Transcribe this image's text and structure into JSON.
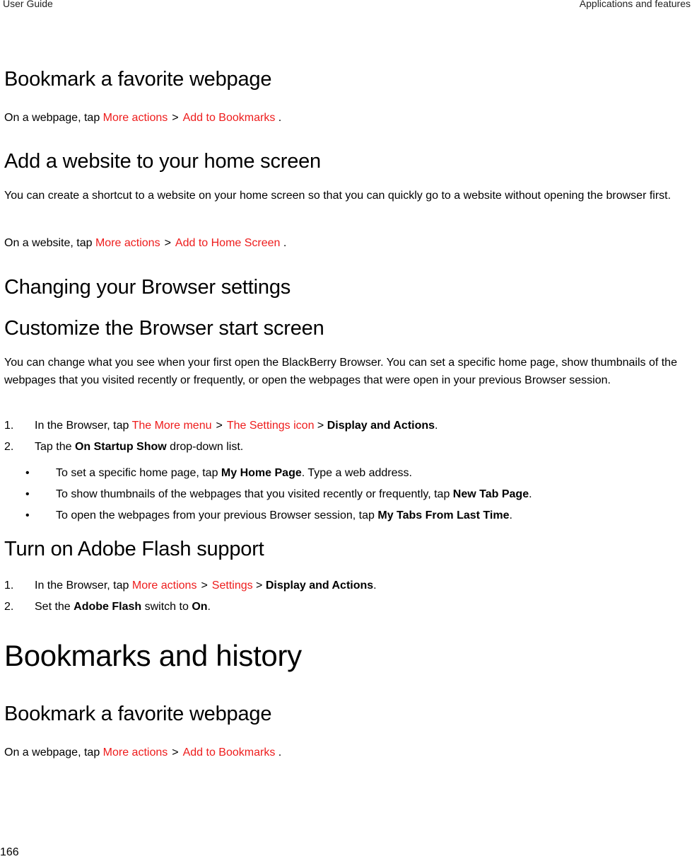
{
  "header": {
    "left": "User Guide",
    "right": "Applications and features"
  },
  "sections": {
    "bookmark1": {
      "title": "Bookmark a favorite webpage",
      "pre": "On a webpage, tap ",
      "link1": "More actions",
      "sep": ">",
      "link2": "Add to Bookmarks",
      "post": " ."
    },
    "homescreen": {
      "title": "Add a website to your home screen",
      "desc": "You can create a shortcut to a website on your home screen so that you can quickly go to a website without opening the browser first.",
      "pre": "On a website, tap ",
      "link1": "More actions",
      "sep": ">",
      "link2": "Add to Home Screen",
      "post": " ."
    },
    "settings": {
      "title": "Changing your Browser settings"
    },
    "startscreen": {
      "title": "Customize the Browser start screen",
      "desc": "You can change what you see when your first open the BlackBerry Browser. You can set a specific home page, show thumbnails of the webpages that you visited recently or frequently, or open the webpages that were open in your previous Browser session.",
      "steps": [
        {
          "num": "1.",
          "pre": "In the Browser, tap ",
          "link1": "The More menu",
          "sep": ">",
          "link2": "The Settings icon",
          "sep2": " > ",
          "bold": "Display and Actions",
          "post": "."
        },
        {
          "num": "2.",
          "pre": "Tap the ",
          "bold": "On Startup Show",
          "post": " drop-down list."
        }
      ],
      "bullets": [
        {
          "mark": "•",
          "pre": "To set a specific home page, tap ",
          "bold": "My Home Page",
          "post": ". Type a web address."
        },
        {
          "mark": "•",
          "pre": "To show thumbnails of the webpages that you visited recently or frequently, tap ",
          "bold": "New Tab Page",
          "post": "."
        },
        {
          "mark": "•",
          "pre": "To open the webpages from your previous Browser session, tap ",
          "bold": "My Tabs From Last Time",
          "post": "."
        }
      ]
    },
    "flash": {
      "title": "Turn on Adobe Flash support",
      "steps": [
        {
          "num": "1.",
          "pre": "In the Browser, tap ",
          "link1": "More actions",
          "sep": ">",
          "link2": "Settings",
          "sep2": " > ",
          "bold": "Display and Actions",
          "post": "."
        },
        {
          "num": "2.",
          "pre": "Set the ",
          "bold": "Adobe Flash",
          "mid": " switch to ",
          "bold2": "On",
          "post": "."
        }
      ]
    },
    "history": {
      "title": "Bookmarks and history"
    },
    "bookmark2": {
      "title": "Bookmark a favorite webpage",
      "pre": "On a webpage, tap ",
      "link1": "More actions",
      "sep": ">",
      "link2": "Add to Bookmarks",
      "post": " ."
    }
  },
  "footer": {
    "page_number": "166"
  },
  "colors": {
    "link": "#ee1c1c",
    "text": "#000000"
  }
}
